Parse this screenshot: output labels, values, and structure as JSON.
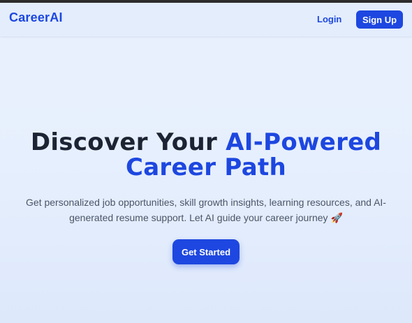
{
  "nav": {
    "brand": "CareerAI",
    "login_label": "Login",
    "signup_label": "Sign Up"
  },
  "hero": {
    "title_part1": "Discover Your ",
    "title_accent": "AI-Powered Career Path",
    "subtitle": "Get personalized job opportunities, skill growth insights, learning resources, and AI-generated resume support. Let AI guide your career journey 🚀",
    "cta_label": "Get Started"
  },
  "colors": {
    "accent": "#1d47e0",
    "heading": "#1c2333",
    "body_text": "#4a5568",
    "background": "#e6effd"
  }
}
